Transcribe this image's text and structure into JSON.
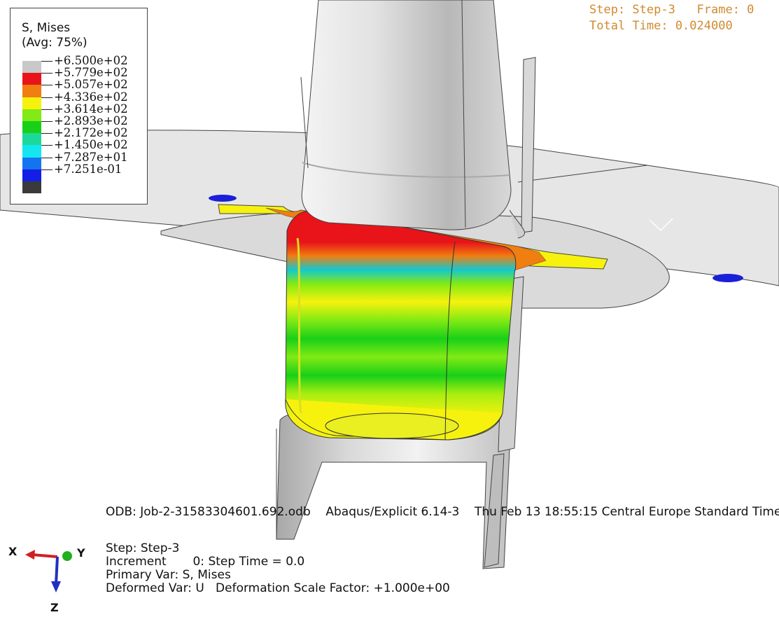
{
  "legend": {
    "title_line1": "S, Mises",
    "title_line2": "(Avg: 75%)",
    "entries": [
      {
        "label": "+6.500e+02",
        "color": "#c8c8c8"
      },
      {
        "label": "+5.779e+02",
        "color": "#e8141a"
      },
      {
        "label": "+5.057e+02",
        "color": "#f07e10"
      },
      {
        "label": "+4.336e+02",
        "color": "#f6f20e"
      },
      {
        "label": "+3.614e+02",
        "color": "#82ea14"
      },
      {
        "label": "+2.893e+02",
        "color": "#18d018"
      },
      {
        "label": "+2.172e+02",
        "color": "#1ed89a"
      },
      {
        "label": "+1.450e+02",
        "color": "#14e6f0"
      },
      {
        "label": "+7.287e+01",
        "color": "#1474f0"
      },
      {
        "label": "+7.251e-01",
        "color": "#141ee6"
      },
      {
        "label": "",
        "color": "#3a3a3a"
      }
    ]
  },
  "step_info": {
    "line1": "Step: Step-3   Frame: 0",
    "line2": "Total Time: 0.024000"
  },
  "odb_line": "ODB: Job-2-31583304601.692.odb    Abaqus/Explicit 6.14-3    Thu Feb 13 18:55:15 Central Europe Standard Time",
  "info": {
    "step": "Step: Step-3",
    "increment": "Increment       0: Step Time = 0.0",
    "primary_var": "Primary Var: S, Mises",
    "deformed_var": "Deformed Var: U   Deformation Scale Factor: +1.000e+00"
  },
  "triad": {
    "x_label": "X",
    "y_label": "Y",
    "z_label": "Z",
    "x_color": "#d02020",
    "y_color": "#20b020",
    "z_color": "#2030c0"
  },
  "viewport": {
    "background_color": "#ffffff"
  }
}
